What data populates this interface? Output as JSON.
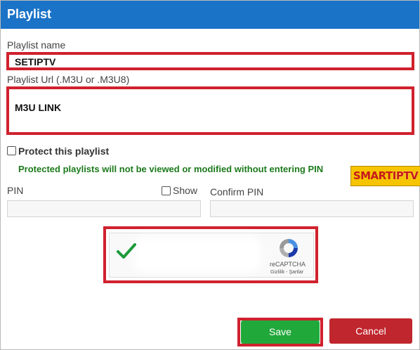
{
  "dialog": {
    "title": "Playlist"
  },
  "fields": {
    "name_label": "Playlist name",
    "name_value": "SETIPTV",
    "url_label": "Playlist Url (.M3U or .M3U8)",
    "url_value": "M3U LINK"
  },
  "protect": {
    "label": "Protect this playlist",
    "note": "Protected playlists will not be viewed or modified without entering PIN"
  },
  "pin": {
    "pin_label": "PIN",
    "show_label": "Show",
    "confirm_label": "Confirm PIN"
  },
  "captcha": {
    "brand": "reCAPTCHA",
    "links": "Gizlilik - Şartlar"
  },
  "logo": {
    "text_a": "SMART",
    "text_b": "IPTV"
  },
  "buttons": {
    "save": "Save",
    "cancel": "Cancel"
  },
  "colors": {
    "header": "#1a73c7",
    "highlight": "#d0212e",
    "save": "#21a83b",
    "cancel": "#c0262d",
    "note": "#1c7a1c"
  }
}
